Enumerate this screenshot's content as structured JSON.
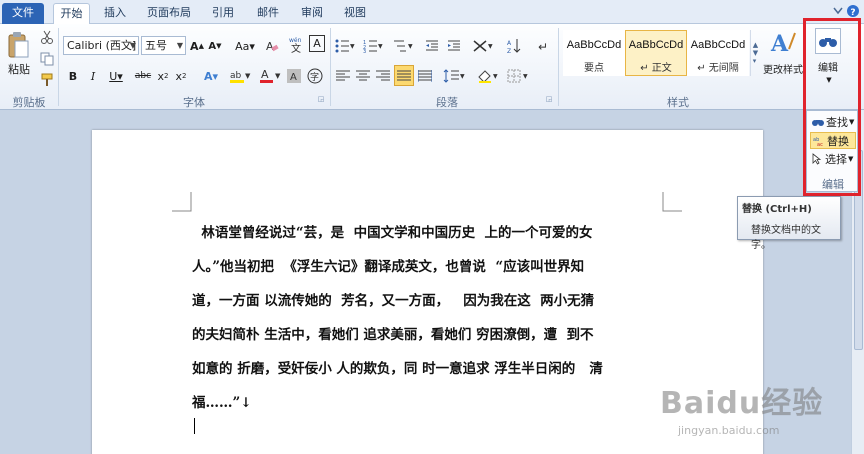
{
  "tabs": [
    {
      "label": "文件",
      "kind": "file"
    },
    {
      "label": "开始",
      "kind": "active"
    },
    {
      "label": "插入",
      "kind": "normal"
    },
    {
      "label": "页面布局",
      "kind": "normal"
    },
    {
      "label": "引用",
      "kind": "normal"
    },
    {
      "label": "邮件",
      "kind": "normal"
    },
    {
      "label": "审阅",
      "kind": "normal"
    },
    {
      "label": "视图",
      "kind": "normal"
    }
  ],
  "clipboard": {
    "paste_label": "粘贴",
    "group_label": "剪贴板"
  },
  "font": {
    "family_value": "Calibri (西文]",
    "size_value": "五号",
    "group_label": "字体"
  },
  "paragraph": {
    "group_label": "段落"
  },
  "styles": {
    "items": [
      {
        "sample": "AaBbCcDd",
        "name": "要点",
        "selected": false
      },
      {
        "sample": "AaBbCcDd",
        "name": "↵ 正文",
        "selected": true
      },
      {
        "sample": "AaBbCcDd",
        "name": "↵ 无间隔",
        "selected": false
      }
    ],
    "change_label": "更改样式",
    "group_label": "样式"
  },
  "editing": {
    "button_label": "编辑",
    "find_label": "查找",
    "replace_label": "替换",
    "select_label": "选择",
    "group_label": "编辑"
  },
  "tooltip": {
    "title": "替换 (Ctrl+H)",
    "description": "替换文档中的文字。"
  },
  "document": {
    "lines": [
      "  林语堂曾经说过“芸，是  中国文学和中国历史  上的一个可爱的女",
      "人。”他当初把  《浮生六记》翻译成英文，也曾说  “应该叫世界知",
      "道，一方面 以流传她的  芳名，又一方面，   因为我在这  两小无猜",
      "的夫妇简朴 生活中，看她们 追求美丽，看她们 穷困潦倒，遭  到不",
      "如意的 折磨，受奸佞小 人的欺负，同 时一意追求 浮生半日闲的   清",
      "福……”↓"
    ]
  },
  "watermark": {
    "logo": "Baidu经验",
    "url": "jingyan.baidu.com"
  },
  "colors": {
    "accent_red": "#e0232c",
    "file_tab": "#2c64b5",
    "highlight": "#fde79a"
  }
}
